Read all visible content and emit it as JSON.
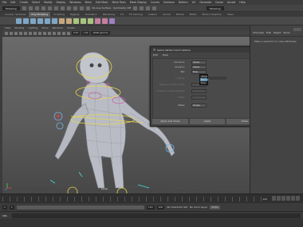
{
  "menubar": [
    "File",
    "Edit",
    "Create",
    "Select",
    "Modify",
    "Display",
    "Windows",
    "Mesh",
    "Edit Mesh",
    "Mesh Tools",
    "Mesh Display",
    "Curves",
    "Surfaces",
    "Deform",
    "UV",
    "Generate",
    "Cache",
    "Arnold",
    "Help"
  ],
  "status": {
    "workspace": "Modeling",
    "no_live_surface": "No Live Surface",
    "symmetry": "Symmetry: Off",
    "workspace_right": "Modeling"
  },
  "shelf_tabs": [
    "Curves / Surfaces",
    "Poly Modeling",
    "Sculpting",
    "Rigging",
    "Animation",
    "Rendering",
    "FX",
    "FX Caching",
    "Custom",
    "Arnold",
    "Bifrost",
    "MASH",
    "Motion Graphics",
    "XGen"
  ],
  "shelf_active_index": 1,
  "panel_menu": [
    "View",
    "Shading",
    "Lighting",
    "Show",
    "Renderer",
    "Panels"
  ],
  "panel_tools": {
    "field_a": "0.00",
    "field_b": "1.00",
    "color_space": "sRGB gamma",
    "camera_label": "persp"
  },
  "channel_box": {
    "tabs": [
      "Channels",
      "Edit",
      "Object",
      "Show"
    ],
    "message": "Make a selection to view attributes"
  },
  "dialog": {
    "title": "Game Vertex Count Options",
    "menu": [
      "Edit",
      "Help"
    ],
    "rows": [
      {
        "label": "Count on:",
        "value": "Vertex",
        "dim": false
      },
      {
        "label": "Count in:",
        "value": "Vertex",
        "dim": false
      },
      {
        "label": "Per:",
        "value": "Face",
        "dim": false
      },
      {
        "label": "Limit to:",
        "value": "",
        "dim": true
      },
      {
        "label": "Preserve vertex colors:",
        "value": "",
        "dim": true
      },
      {
        "label": "Preserve vertex weights:",
        "value": "",
        "dim": true
      },
      {
        "label": "Mode:",
        "value": "",
        "dim": true
      },
      {
        "label": "Mode:",
        "value": "Simple",
        "dim": false
      }
    ],
    "popup": [
      "Vertex",
      "Normal",
      "Face"
    ],
    "popup_selected": 1,
    "buttons": [
      "Apply and Close",
      "Apply",
      "Close"
    ]
  },
  "timeline": {
    "current_frame": "120"
  },
  "range": {
    "start": "1",
    "start_inner": "1",
    "end_inner": "120",
    "end": "200",
    "no_character_set": "No Character Set",
    "no_anim_layer": "No Anim Layer",
    "fps": "24 fps"
  },
  "cmdline": {
    "lang": "MEL"
  }
}
